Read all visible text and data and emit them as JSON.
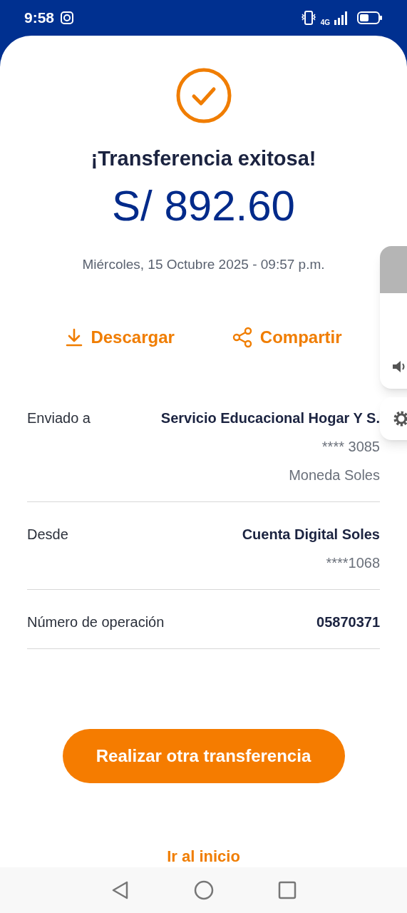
{
  "status_bar": {
    "time": "9:58",
    "network": "4G"
  },
  "title": "¡Transferencia exitosa!",
  "amount": "S/ 892.60",
  "date": "Miércoles, 15 Octubre 2025 - 09:57 p.m.",
  "actions": [
    {
      "kind": "download",
      "label": "Descargar"
    },
    {
      "kind": "share",
      "label": "Compartir"
    }
  ],
  "details": [
    {
      "label": "Enviado a",
      "values": [
        "Servicio Educacional Hogar Y S.",
        "**** 3085",
        "Moneda Soles"
      ]
    },
    {
      "label": "Desde",
      "values": [
        "Cuenta Digital Soles",
        "****1068"
      ]
    },
    {
      "label": "Número de operación",
      "values": [
        "05870371"
      ]
    }
  ],
  "primary_button": "Realizar otra transferencia",
  "secondary_link": "Ir al inicio"
}
